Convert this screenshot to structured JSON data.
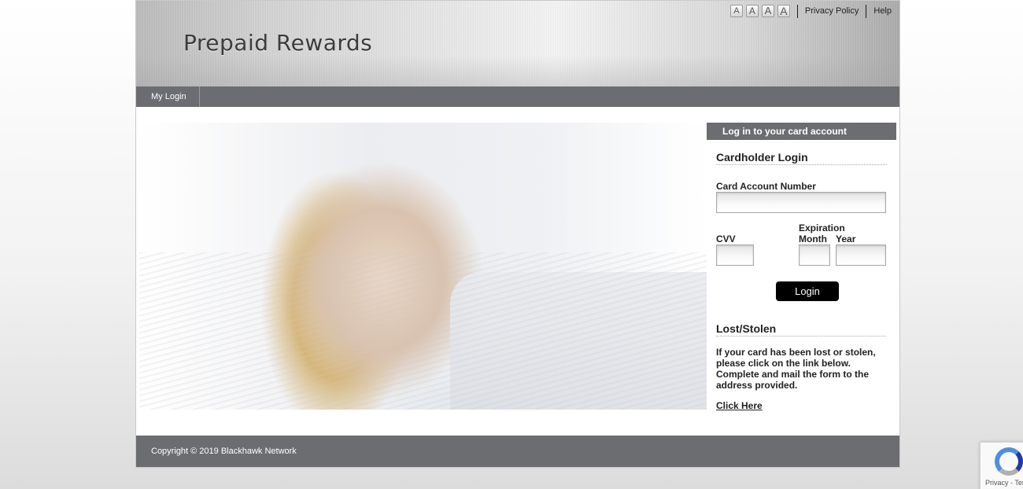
{
  "header": {
    "brand": "Prepaid Rewards",
    "font_size_buttons": [
      "A",
      "A",
      "A",
      "A"
    ],
    "links": {
      "privacy": "Privacy Policy",
      "help": "Help"
    }
  },
  "nav": {
    "items": [
      {
        "label": "My Login"
      }
    ]
  },
  "login_panel": {
    "header": "Log in to your card account",
    "cardholder_title": "Cardholder Login",
    "card_number_label": "Card Account Number",
    "card_number_value": "",
    "cvv_label": "CVV",
    "cvv_value": "",
    "expiration_label": "Expiration",
    "month_label": "Month",
    "month_value": "",
    "year_label": "Year",
    "year_value": "",
    "login_button": "Login"
  },
  "lost_stolen": {
    "title": "Lost/Stolen",
    "text": "If your card has been lost or stolen, please click on the link below. Complete and mail the form to the address provided.",
    "link": "Click Here"
  },
  "footer": {
    "copyright": "Copyright © 2019 Blackhawk Network"
  },
  "recaptcha": {
    "text": "Privacy - Terms"
  },
  "colors": {
    "nav_bg": "#6b6d70",
    "button_bg": "#000000",
    "accent_text": "#222222"
  },
  "icons": {
    "recaptcha": "recaptcha-logo-icon"
  }
}
